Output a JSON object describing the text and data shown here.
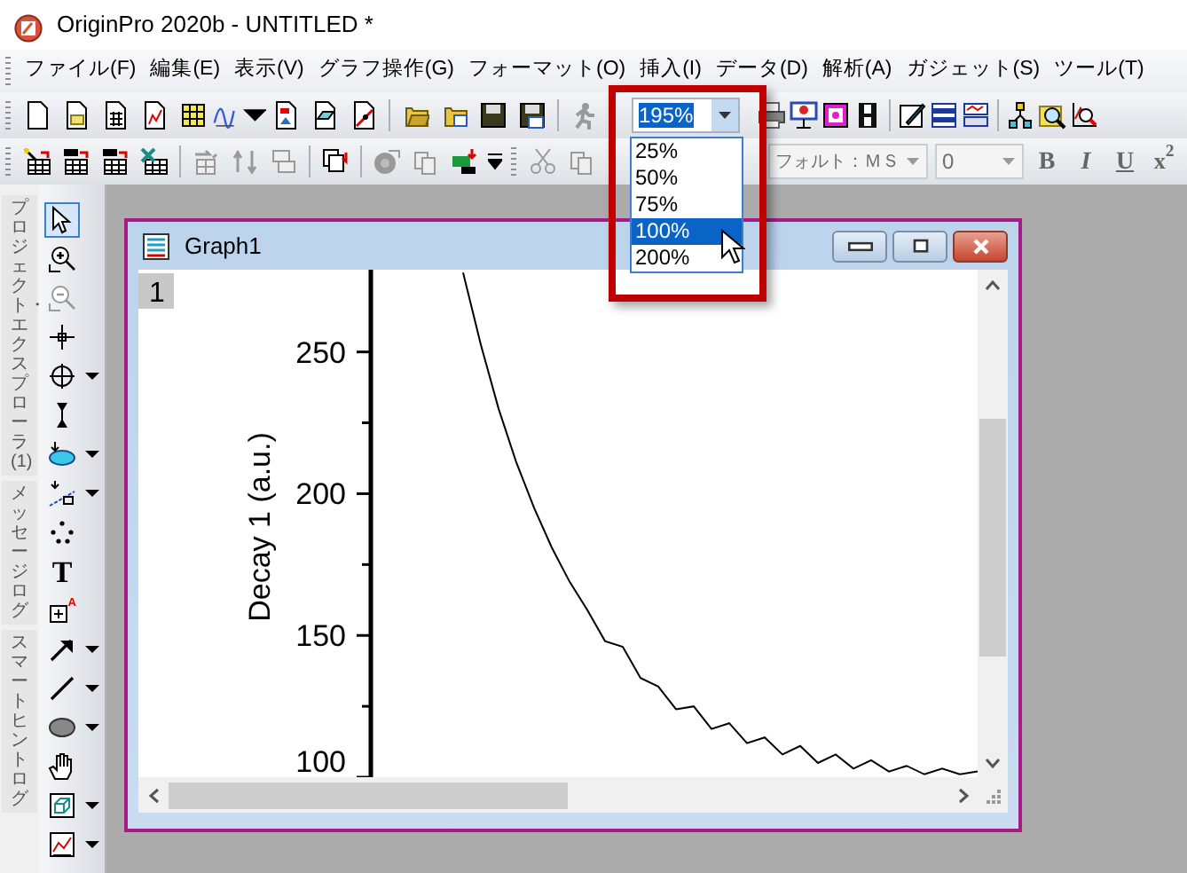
{
  "window": {
    "title": "OriginPro 2020b - UNTITLED *"
  },
  "menu": [
    "ファイル(F)",
    "編集(E)",
    "表示(V)",
    "グラフ操作(G)",
    "フォーマット(O)",
    "挿入(I)",
    "データ(D)",
    "解析(A)",
    "ガジェット(S)",
    "ツール(T)"
  ],
  "zoom_combo": {
    "value": "195%",
    "expanded": true,
    "options": [
      {
        "label": "25%",
        "selected": false
      },
      {
        "label": "50%",
        "selected": false
      },
      {
        "label": "75%",
        "selected": false
      },
      {
        "label": "100%",
        "selected": true
      },
      {
        "label": "200%",
        "selected": false
      }
    ]
  },
  "font_combo": {
    "value": "フォルト：ＭＳ",
    "disabled": true
  },
  "size_combo": {
    "value": "0",
    "disabled": true
  },
  "format_buttons": [
    {
      "label": "B",
      "kind": "bold"
    },
    {
      "label": "I",
      "kind": "italic"
    },
    {
      "label": "U",
      "kind": "underline"
    },
    {
      "label": "x$^{2}$",
      "kind": "superscript"
    }
  ],
  "side_tabs": [
    "プロジェクト・エクスプローラ(1)",
    "メッセージログ",
    "スマートヒントログ"
  ],
  "tools": [
    {
      "kind": "pointer",
      "selected": true
    },
    {
      "kind": "zoom_in",
      "selected": false
    },
    {
      "kind": "zoom_out",
      "selected": false
    },
    {
      "kind": "crosshair",
      "selected": false
    },
    {
      "kind": "target",
      "selected": false
    },
    {
      "kind": "arrows",
      "selected": false
    },
    {
      "kind": "ellipse_pick",
      "selected": false
    },
    {
      "kind": "mask",
      "selected": false
    },
    {
      "kind": "dots",
      "selected": false
    },
    {
      "kind": "text",
      "glyph": "T",
      "selected": false
    },
    {
      "kind": "layer",
      "glyph": "A",
      "selected": false
    },
    {
      "kind": "arrow",
      "selected": false
    },
    {
      "kind": "line",
      "selected": false
    },
    {
      "kind": "ellipse",
      "selected": false
    },
    {
      "kind": "hand",
      "selected": false
    },
    {
      "kind": "cube",
      "selected": false
    },
    {
      "kind": "chart",
      "selected": false
    }
  ],
  "graph_window": {
    "title": "Graph1",
    "layer": "1",
    "chart_data": {
      "type": "line",
      "ylabel": "Decay 1 (a.u.)",
      "ylim": [
        100,
        278
      ],
      "yticks": [
        100,
        150,
        200,
        250
      ],
      "series": [
        {
          "color": "#000000",
          "values": [
            278,
            252.6,
            230,
            211,
            195,
            181,
            169,
            159,
            148,
            146,
            135,
            132,
            124,
            125,
            117,
            119,
            112,
            114,
            108,
            111,
            105,
            108,
            103,
            106,
            102,
            104,
            101,
            103,
            101,
            102
          ]
        }
      ]
    }
  }
}
